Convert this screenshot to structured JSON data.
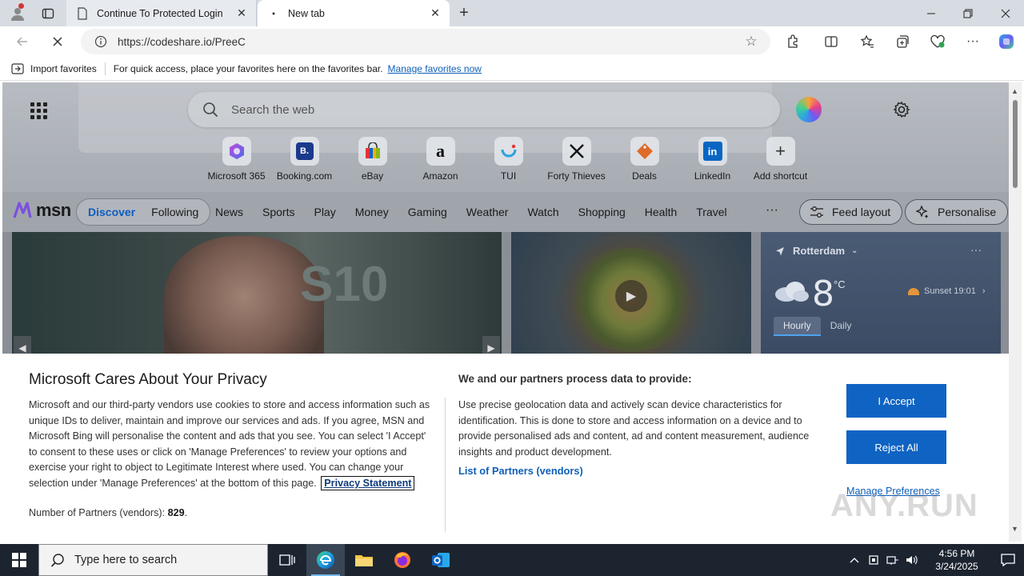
{
  "browser": {
    "tabs": [
      {
        "title": "Continue To Protected Login",
        "icon": "document-icon"
      },
      {
        "title": "New tab",
        "icon": "loading-dot-icon"
      }
    ],
    "url": "https://codeshare.io/PreeC",
    "favorites_bar": {
      "import_label": "Import favorites",
      "message": "For quick access, place your favorites here on the favorites bar.",
      "manage_link": "Manage favorites now"
    }
  },
  "newtab": {
    "search_placeholder": "Search the web",
    "shortcuts": [
      {
        "label": "Microsoft 365",
        "glyph": ""
      },
      {
        "label": "Booking.com",
        "glyph": "B."
      },
      {
        "label": "eBay",
        "glyph": ""
      },
      {
        "label": "Amazon",
        "glyph": "a"
      },
      {
        "label": "TUI",
        "glyph": ""
      },
      {
        "label": "Forty Thieves",
        "glyph": ""
      },
      {
        "label": "Deals",
        "glyph": ""
      },
      {
        "label": "LinkedIn",
        "glyph": "in"
      },
      {
        "label": "Add shortcut",
        "glyph": "+"
      }
    ],
    "msn": {
      "logo": "msn",
      "pills": [
        "Discover",
        "Following"
      ],
      "nav": [
        "News",
        "Sports",
        "Play",
        "Money",
        "Gaming",
        "Weather",
        "Watch",
        "Shopping",
        "Health",
        "Travel"
      ],
      "more": "···",
      "feed_layout": "Feed layout",
      "personalise": "Personalise"
    },
    "hero_text": "S10",
    "weather": {
      "location": "Rotterdam",
      "temp": "8",
      "unit": "°C",
      "sunset": "Sunset 19:01",
      "tabs": [
        "Hourly",
        "Daily"
      ]
    }
  },
  "privacy": {
    "title": "Microsoft Cares About Your Privacy",
    "body": "Microsoft and our third-party vendors use cookies to store and access information such as unique IDs to deliver, maintain and improve our services and ads. If you agree, MSN and Microsoft Bing will personalise the content and ads that you see. You can select 'I Accept' to consent to these uses or click on 'Manage Preferences' to review your options and exercise your right to object to Legitimate Interest where used. You can change your selection under 'Manage Preferences' at the bottom of this page.",
    "privacy_link": "Privacy Statement",
    "partners_label": "Number of Partners (vendors):",
    "partners_count": "829",
    "partners_suffix": ".",
    "right_heading": "We and our partners process data to provide:",
    "right_text": "Use precise geolocation data and actively scan device characteristics for identification. This is done to store and access information on a device and to provide personalised ads and content, ad and content measurement, audience insights and product development.",
    "list_link": "List of Partners (vendors)",
    "accept": "I Accept",
    "reject": "Reject All",
    "manage": "Manage Preferences",
    "watermark": "ANY.RUN"
  },
  "taskbar": {
    "search_placeholder": "Type here to search",
    "time": "4:56 PM",
    "date": "3/24/2025"
  },
  "colors": {
    "accent": "#0f63c2",
    "link": "#0f5fb8",
    "taskbar": "#1c2430"
  }
}
